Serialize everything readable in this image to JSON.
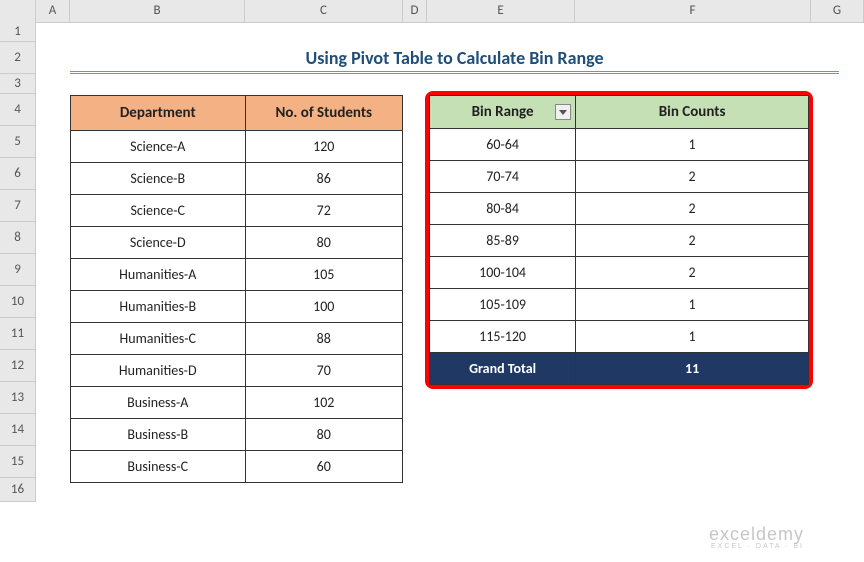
{
  "columns": [
    "A",
    "B",
    "C",
    "D",
    "E",
    "F",
    "G"
  ],
  "rows": [
    "1",
    "2",
    "3",
    "4",
    "5",
    "6",
    "7",
    "8",
    "9",
    "10",
    "11",
    "12",
    "13",
    "14",
    "15",
    "16"
  ],
  "title": "Using Pivot Table to Calculate Bin Range",
  "table1": {
    "headers": {
      "department": "Department",
      "students": "No. of Students"
    },
    "rows": [
      {
        "dept": "Science-A",
        "num": "120"
      },
      {
        "dept": "Science-B",
        "num": "86"
      },
      {
        "dept": "Science-C",
        "num": "72"
      },
      {
        "dept": "Science-D",
        "num": "80"
      },
      {
        "dept": "Humanities-A",
        "num": "105"
      },
      {
        "dept": "Humanities-B",
        "num": "100"
      },
      {
        "dept": "Humanities-C",
        "num": "88"
      },
      {
        "dept": "Humanities-D",
        "num": "70"
      },
      {
        "dept": "Business-A",
        "num": "102"
      },
      {
        "dept": "Business-B",
        "num": "80"
      },
      {
        "dept": "Business-C",
        "num": "60"
      }
    ]
  },
  "table2": {
    "headers": {
      "range": "Bin Range",
      "counts": "Bin Counts"
    },
    "rows": [
      {
        "range": "60-64",
        "count": "1"
      },
      {
        "range": "70-74",
        "count": "2"
      },
      {
        "range": "80-84",
        "count": "2"
      },
      {
        "range": "85-89",
        "count": "2"
      },
      {
        "range": "100-104",
        "count": "2"
      },
      {
        "range": "105-109",
        "count": "1"
      },
      {
        "range": "115-120",
        "count": "1"
      }
    ],
    "total": {
      "label": "Grand Total",
      "value": "11"
    }
  },
  "watermark": {
    "main": "exceldemy",
    "sub": "EXCEL · DATA · BI"
  }
}
